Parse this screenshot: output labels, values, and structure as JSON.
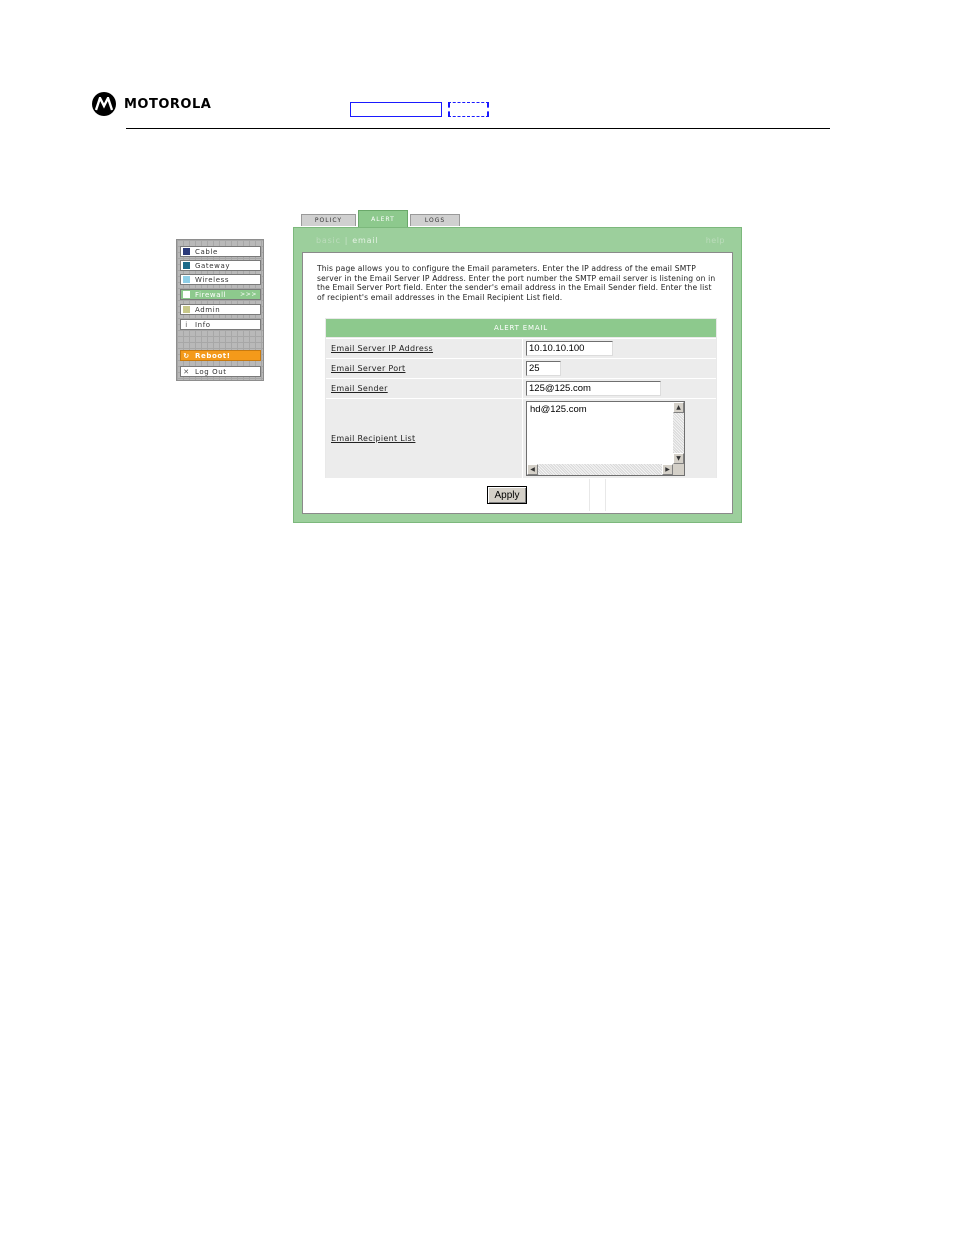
{
  "brand": {
    "name": "MOTOROLA"
  },
  "sidebar": {
    "items": [
      {
        "label": "Cable",
        "color": "#2b3a7a"
      },
      {
        "label": "Gateway",
        "color": "#1b6a8a"
      },
      {
        "label": "Wireless",
        "color": "#8fcfe8"
      },
      {
        "label": "Firewall",
        "color": "#ffffff",
        "arrows": ">>>"
      },
      {
        "label": "Admin",
        "color": "#c8c88a"
      },
      {
        "label": "Info",
        "glyph": "i"
      },
      {
        "label": "Reboot!",
        "glyph": "↻"
      },
      {
        "label": "Log Out",
        "glyph": "✕"
      }
    ]
  },
  "tabs": [
    {
      "label": "POLICY"
    },
    {
      "label": "ALERT"
    },
    {
      "label": "LOGS"
    }
  ],
  "subnav": {
    "basic": "basic",
    "separator": "|",
    "email": "email",
    "help": "help"
  },
  "description": "This page allows you to configure the Email parameters. Enter the IP address of the email SMTP server in the Email Server IP Address. Enter the port number the SMTP email server is listening on in the Email Server Port field. Enter the sender's email address in the Email Sender field. Enter the list of recipient's email addresses in the Email Recipient List field.",
  "form": {
    "title": "ALERT EMAIL",
    "server_ip": {
      "label": "Email Server IP Address",
      "value": "10.10.10.100"
    },
    "server_port": {
      "label": "Email Server Port",
      "value": "25"
    },
    "sender": {
      "label": "Email Sender",
      "value": "125@125.com"
    },
    "recipients": {
      "label": "Email Recipient List",
      "value": "hd@125.com"
    },
    "apply_label": "Apply"
  },
  "colors": {
    "accent": "#8dc98d",
    "panel": "#9ccf9c",
    "reboot": "#f49a1a"
  }
}
